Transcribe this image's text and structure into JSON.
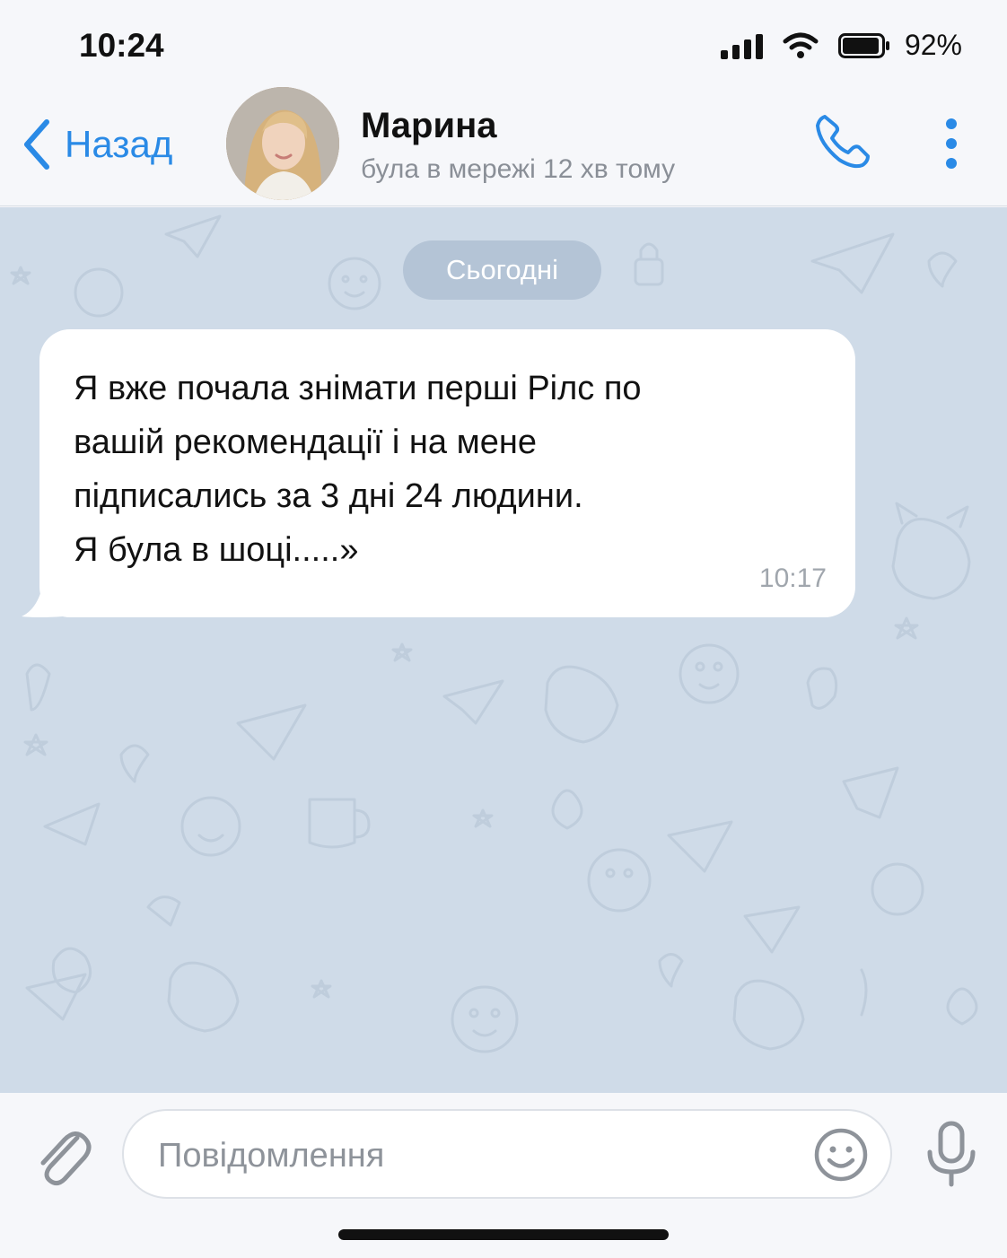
{
  "status_bar": {
    "time": "10:24",
    "battery_percent": "92%",
    "signal_icon": "cellular-signal-icon",
    "wifi_icon": "wifi-icon",
    "battery_icon": "battery-icon"
  },
  "header": {
    "back_label": "Назад",
    "back_icon": "chevron-left-icon",
    "contact_name": "Марина",
    "contact_status": "була в мережі 12 хв тому",
    "call_icon": "phone-icon",
    "more_icon": "more-vertical-icon"
  },
  "chat": {
    "date_label": "Сьогодні",
    "messages": [
      {
        "lines": [
          "Я вже почала знімати перші Рілс по",
          "вашій рекомендації і на мене",
          "підписались за 3 дні 24 людини.",
          "Я була в шоці.....»"
        ],
        "time": "10:17",
        "direction": "incoming"
      }
    ]
  },
  "input_bar": {
    "placeholder": "Повідомлення",
    "attach_icon": "paperclip-icon",
    "emoji_icon": "emoji-icon",
    "mic_icon": "microphone-icon"
  },
  "colors": {
    "accent": "#2a8ae6",
    "chat_background": "#cfdbe8",
    "date_pill": "#b4c4d6",
    "bubble": "#ffffff"
  }
}
